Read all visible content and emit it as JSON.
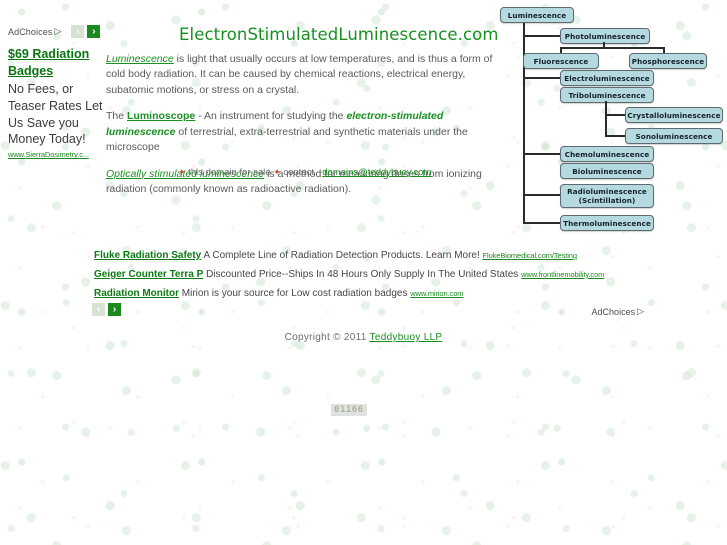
{
  "page": {
    "title": "ElectronStimulatedLuminescence.com",
    "copyright_prefix": "Copyright © 2011",
    "copyright_link": "Teddybuoy LLP",
    "hit_counter": "01166"
  },
  "ads": {
    "adchoices_label": "AdChoices",
    "adchoices_icon": "triangle-right-icon",
    "prev_arrow": "‹",
    "next_arrow": "›",
    "left": {
      "title": "$69 Radiation Badges",
      "body": "No Fees, or Teaser Rates Let Us Save you Money Today!",
      "url": "www.SierraDosimetry.c..."
    },
    "bottom": [
      {
        "title": "Fluke Radiation Safety",
        "desc": "A Complete Line of Radiation Detection Products. Learn More!",
        "url": "FlukeBiomedical.com/Testing"
      },
      {
        "title": "Geiger Counter Terra P",
        "desc": "Discounted Price--Ships In 48 Hours Only Supply In The United States",
        "url": "www.frontlinemobility.com"
      },
      {
        "title": "Radiation Monitor",
        "desc": "Mirion is your source for Low cost radiation badges",
        "url": "www.mirion.com"
      }
    ]
  },
  "article": {
    "p1_link": "Luminescence",
    "p1_rest": " is light that usually occurs at low temperatures, and is thus a form of cold body radiation. It can be caused by chemical reactions, electrical energy, subatomic motions, or stress on a crystal.",
    "p2_prefix": "The ",
    "p2_link": "Luminoscope",
    "p2_mid": " - An instrument for studying the ",
    "p2_em": "electron-stimulated luminescence",
    "p2_rest": " of terrestrial, extra-terrestrial and synthetic materials under the microscope",
    "p3_link": "Optically stimulated luminescence",
    "p3_rest": " is a method for measuring doses from ionizing radiation (commonly known as radioactive radiation)."
  },
  "forsale": {
    "star": "✦",
    "text1": "this domain for sale",
    "text2": "contact ~",
    "email": "domains@teddybuoy.com"
  },
  "diagram": {
    "nodes": {
      "luminescence": "Luminescence",
      "photoluminescence": "Photoluminescence",
      "fluorescence": "Fluorescence",
      "phosphorescence": "Phosphorescence",
      "electroluminescence": "Electroluminescence",
      "triboluminescence": "Triboluminescence",
      "crystalloluminescence": "Crystalloluminescence",
      "sonoluminescence": "Sonoluminescence",
      "chemoluminescence": "Chemoluminescence",
      "bioluminescence": "Bioluminescence",
      "radioluminescence": "Radioluminescence\n(Scintillation)",
      "thermoluminescence": "Thermoluminescence"
    },
    "box_fill": "#b4d9de",
    "box_border": "#5d6b70",
    "line_color": "#2b2b2b"
  }
}
